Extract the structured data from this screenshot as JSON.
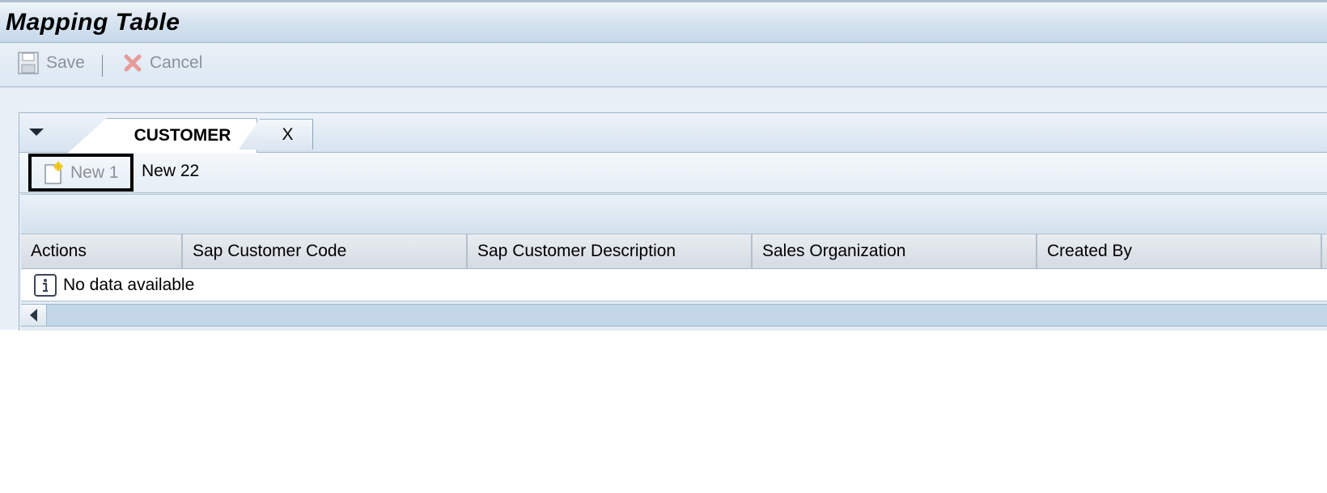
{
  "window": {
    "title": "Mapping Table"
  },
  "toolbar": {
    "save_label": "Save",
    "cancel_label": "Cancel"
  },
  "tabs": [
    {
      "label": "CUSTOMER",
      "active": true
    },
    {
      "label": "X",
      "active": false
    }
  ],
  "subbar": {
    "new1_label": "New 1",
    "new22_label": "New 22"
  },
  "table": {
    "columns": [
      "Actions",
      "Sap Customer Code",
      "Sap Customer Description",
      "Sales Organization",
      "Created By"
    ],
    "empty_message": "No data available"
  },
  "icons": {
    "save": "floppy-disk-icon",
    "cancel": "red-x-icon",
    "new": "new-document-icon",
    "info": "info-icon",
    "tab_toggle": "triangle-down-icon",
    "scroll_left": "scroll-left-arrow-icon"
  },
  "colors": {
    "accent": "#c6d8ea",
    "cancel_icon": "#e07a7a",
    "new_icon_star": "#f2d23a"
  }
}
